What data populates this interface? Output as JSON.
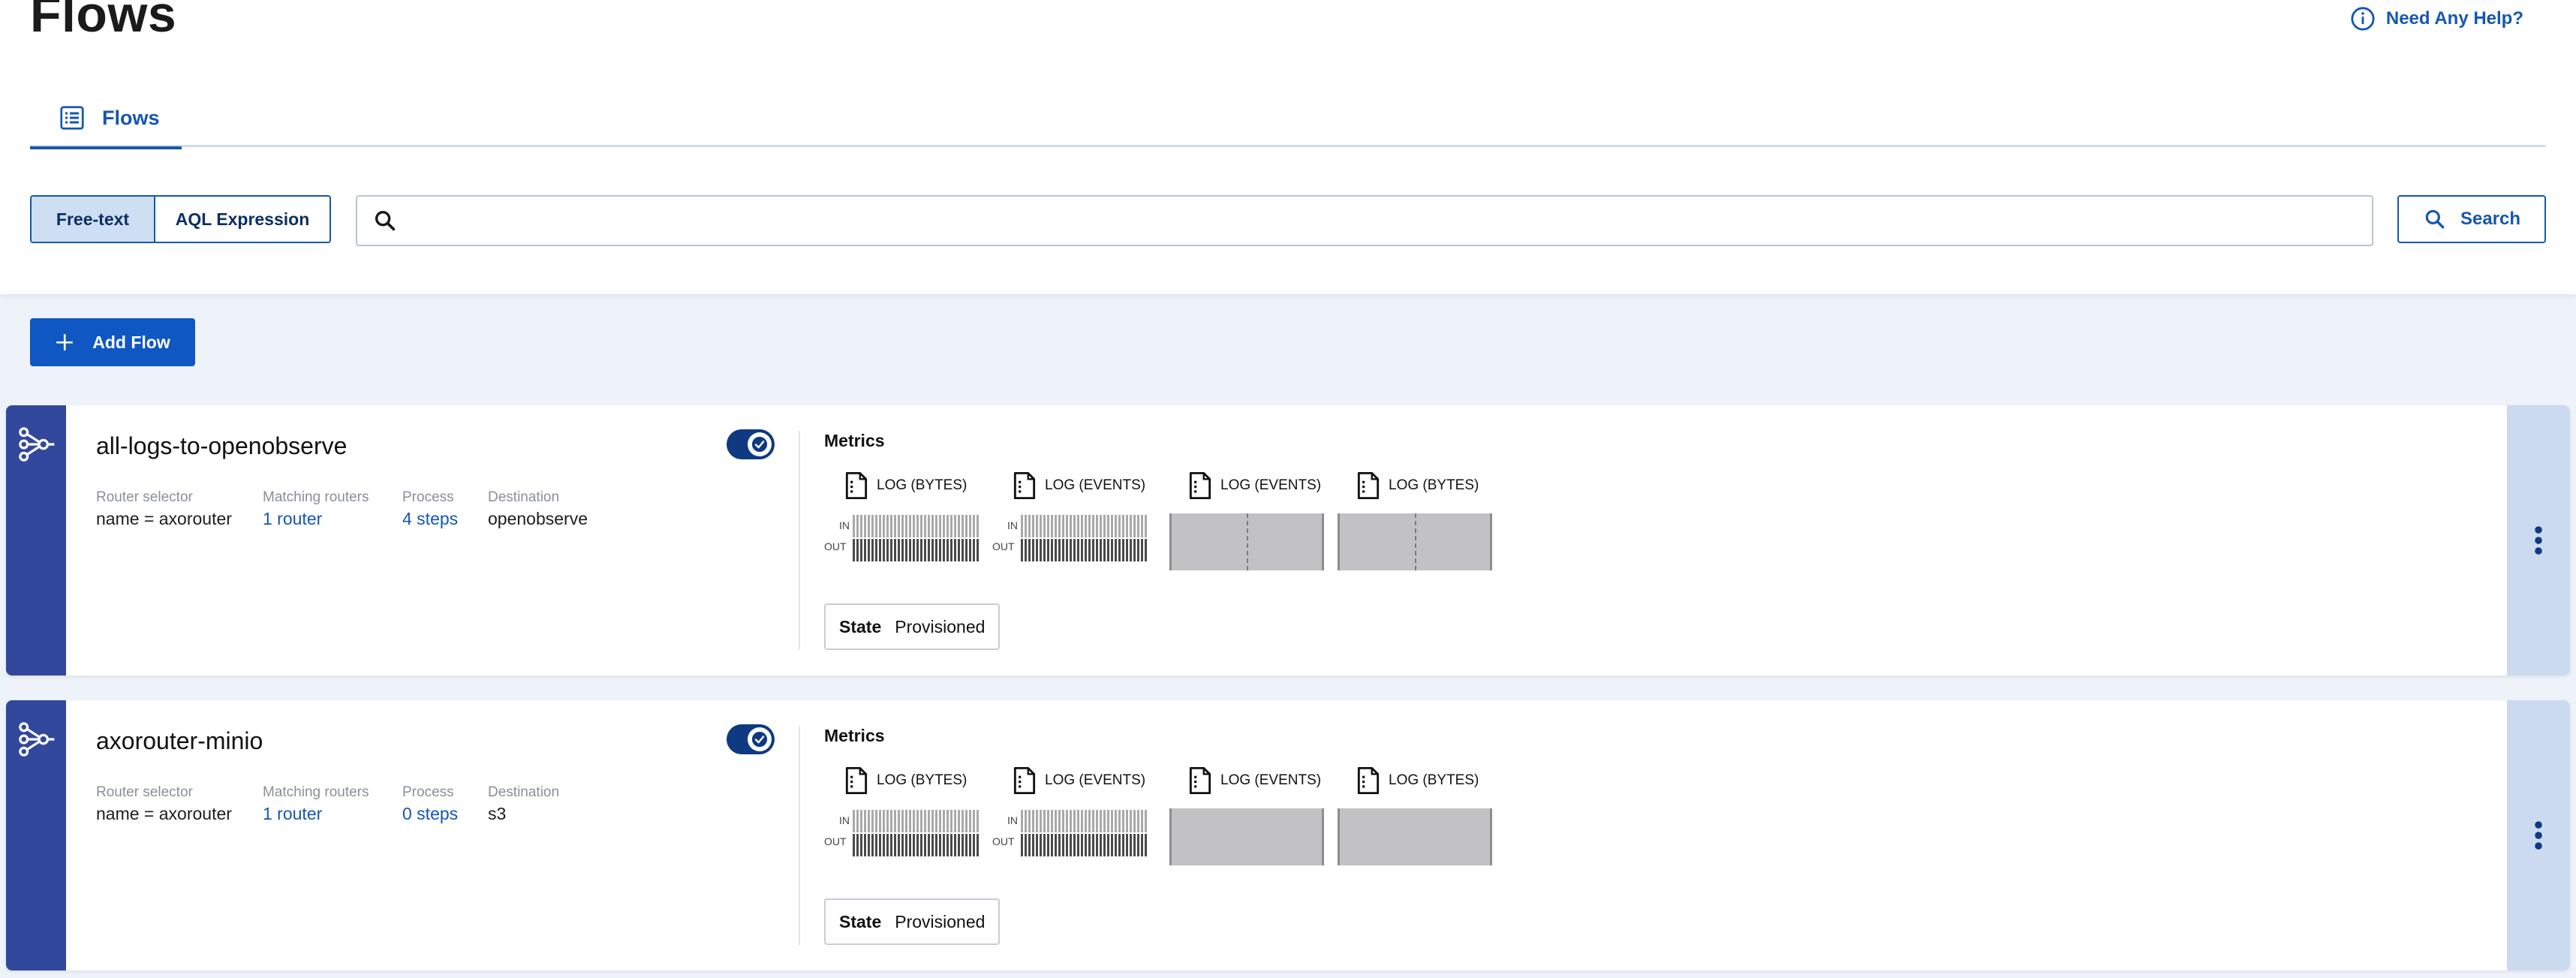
{
  "page": {
    "title": "Flows",
    "help_label": "Need Any Help?"
  },
  "tabs": [
    {
      "label": "Flows",
      "icon": "list-icon"
    }
  ],
  "search": {
    "modes": [
      "Free-text",
      "AQL Expression"
    ],
    "active_mode": "Free-text",
    "query": "",
    "placeholder": "",
    "button_label": "Search"
  },
  "actions": {
    "add_flow_label": "Add Flow"
  },
  "flows": [
    {
      "name": "all-logs-to-openobserve",
      "enabled": true,
      "meta": [
        {
          "label": "Router selector",
          "value": "name = axorouter"
        },
        {
          "label": "Matching routers",
          "value": "1 router"
        },
        {
          "label": "Process",
          "value": "4 steps"
        },
        {
          "label": "Destination",
          "value": "openobserve"
        }
      ],
      "metrics_title": "Metrics",
      "metrics": [
        {
          "label": "LOG (BYTES)",
          "kind": "in-out",
          "in_label": "IN",
          "out_label": "OUT"
        },
        {
          "label": "LOG (EVENTS)",
          "kind": "in-out",
          "in_label": "IN",
          "out_label": "OUT"
        },
        {
          "label": "LOG (EVENTS)",
          "kind": "empty"
        },
        {
          "label": "LOG (BYTES)",
          "kind": "empty"
        }
      ],
      "state_label": "State",
      "state_value": "Provisioned"
    },
    {
      "name": "axorouter-minio",
      "enabled": true,
      "meta": [
        {
          "label": "Router selector",
          "value": "name = axorouter"
        },
        {
          "label": "Matching routers",
          "value": "1 router"
        },
        {
          "label": "Process",
          "value": "0 steps"
        },
        {
          "label": "Destination",
          "value": "s3"
        }
      ],
      "metrics_title": "Metrics",
      "metrics": [
        {
          "label": "LOG (BYTES)",
          "kind": "in-out",
          "in_label": "IN",
          "out_label": "OUT"
        },
        {
          "label": "LOG (EVENTS)",
          "kind": "in-out",
          "in_label": "IN",
          "out_label": "OUT"
        },
        {
          "label": "LOG (EVENTS)",
          "kind": "empty"
        },
        {
          "label": "LOG (BYTES)",
          "kind": "empty"
        }
      ],
      "state_label": "State",
      "state_value": "Provisioned"
    }
  ],
  "colors": {
    "accent": "#1557b0",
    "primary_button": "#0f57c2",
    "card_side": "#31489c",
    "toggle_on": "#0f3a82",
    "page_bg": "#eef3fa"
  }
}
